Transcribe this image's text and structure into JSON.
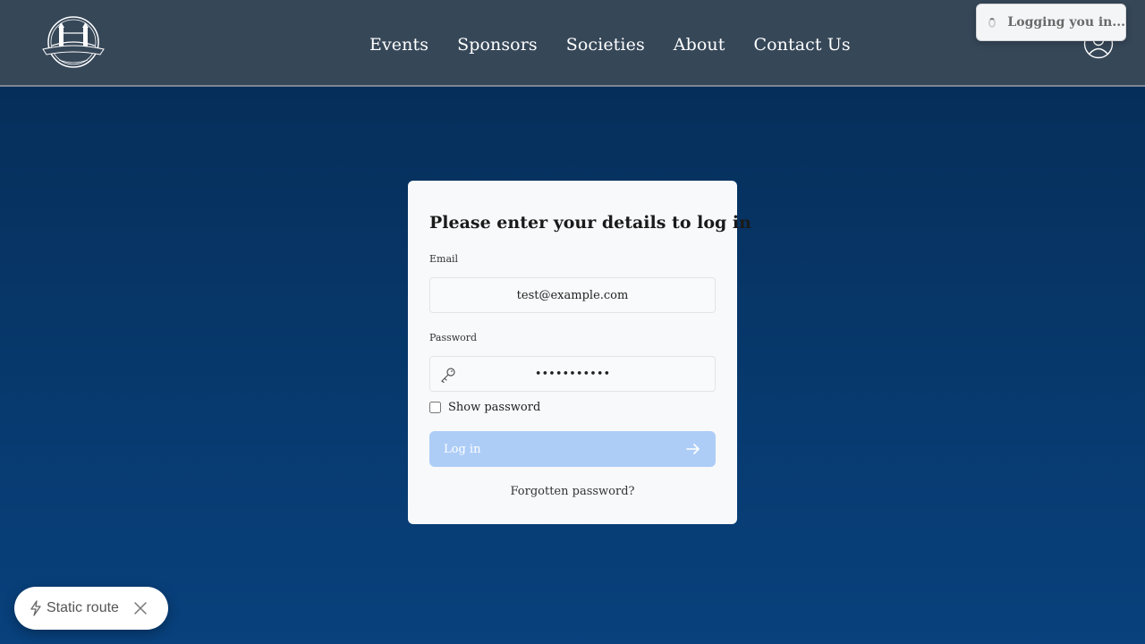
{
  "navbar": {
    "logo_alt": "London Student Network",
    "links": [
      "Events",
      "Sponsors",
      "Societies",
      "About",
      "Contact Us"
    ],
    "user_icon": "user-circle-icon"
  },
  "toast": {
    "text": "Logging you in..."
  },
  "login": {
    "title": "Please enter your details to log in",
    "email_label": "Email",
    "email_value": "test@example.com",
    "password_label": "Password",
    "password_value": "password123",
    "show_password_label": "Show password",
    "show_password_checked": false,
    "login_button": "Log in",
    "forgot_link": "Forgotten password?"
  },
  "dev_indicator": {
    "label": "Static route"
  },
  "colors": {
    "navbar_bg": "#364758",
    "page_bg_top": "#062b55",
    "page_bg_bottom": "#08417d",
    "card_bg": "#f8f9fb",
    "button_bg": "#adcdf7"
  }
}
